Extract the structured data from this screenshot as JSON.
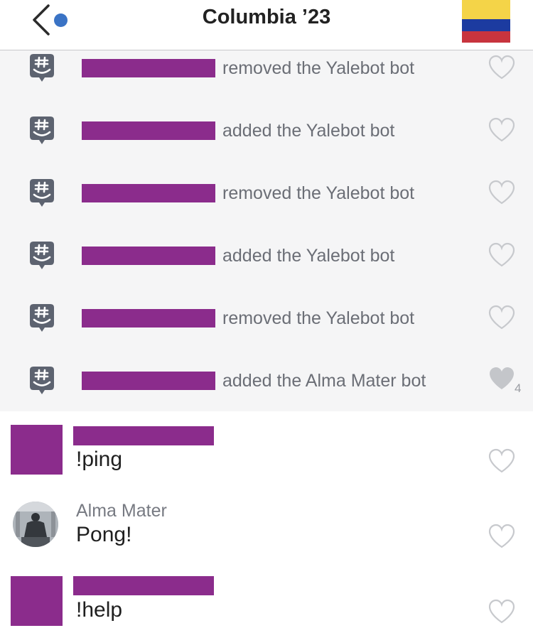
{
  "header": {
    "title": "Columbia ’23",
    "back_icon": "chevron-left-icon",
    "unread_color": "#3a73c5",
    "flag": {
      "colors": [
        "#f4d448",
        "#1c3ba0",
        "#c8343e"
      ]
    }
  },
  "system_messages": [
    {
      "text": "removed the Yalebot bot",
      "liked": false,
      "likes": ""
    },
    {
      "text": "added the Yalebot bot",
      "liked": false,
      "likes": ""
    },
    {
      "text": "removed the Yalebot bot",
      "liked": false,
      "likes": ""
    },
    {
      "text": "added the Yalebot bot",
      "liked": false,
      "likes": ""
    },
    {
      "text": "removed the Yalebot bot",
      "liked": false,
      "likes": ""
    },
    {
      "text": "added the Alma Mater bot",
      "liked": true,
      "likes": "4"
    }
  ],
  "messages": [
    {
      "sender": "",
      "text": "!ping",
      "avatar": "redacted"
    },
    {
      "sender": "Alma Mater",
      "text": "Pong!",
      "avatar": "statue-photo"
    },
    {
      "sender": "",
      "text": "!help",
      "avatar": "redacted"
    }
  ],
  "colors": {
    "redaction": "#8b2c8c",
    "system_bg": "#f5f5f6",
    "heart_outline": "#c7c9cd",
    "heart_filled": "#c4c6ca"
  }
}
